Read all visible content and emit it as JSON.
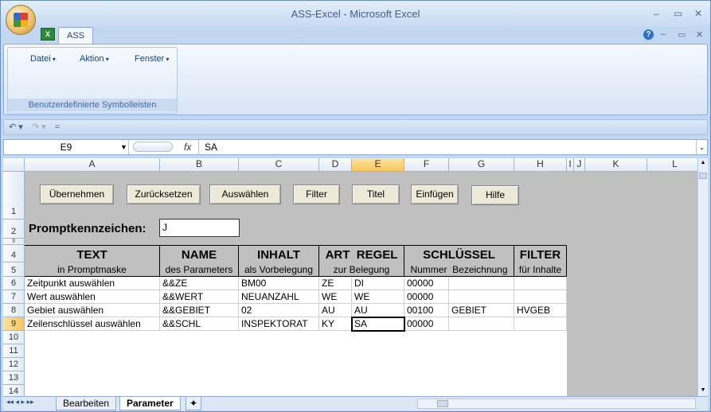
{
  "window": {
    "title": "ASS-Excel - Microsoft Excel",
    "doc_tab": "ASS",
    "min": "–",
    "max": "▭",
    "close": "✕",
    "help": "?",
    "min2": "–",
    "restore2": "▭",
    "close2": "✕"
  },
  "ribbon": {
    "menus": [
      "Datei",
      "Aktion",
      "Fenster"
    ],
    "group_label": "Benutzerdefinierte Symbolleisten"
  },
  "qat": {
    "undo": "↶ ▾",
    "redo": "↷ ▾",
    "custom": "="
  },
  "formula_bar": {
    "name_box": "E9",
    "fx": "fx",
    "value": "SA"
  },
  "columns": [
    "A",
    "B",
    "C",
    "D",
    "E",
    "F",
    "G",
    "H",
    "I",
    "J",
    "K",
    "L"
  ],
  "rows": [
    "1",
    "2",
    "3",
    "4",
    "5",
    "6",
    "7",
    "8",
    "9",
    "10",
    "11",
    "12",
    "13",
    "14"
  ],
  "buttons": [
    "Übernehmen",
    "Zurücksetzen",
    "Auswählen",
    "Filter",
    "Titel",
    "Einfügen",
    "Hilfe"
  ],
  "prompt": {
    "label": "Promptkennzeichen:",
    "value": "J"
  },
  "table_headers": {
    "top": [
      "TEXT",
      "NAME",
      "INHALT",
      "ART",
      "REGEL",
      "SCHLÜSSEL",
      "FILTER"
    ],
    "bottom": [
      "in Promptmaske",
      "des Parameters",
      "als Vorbelegung",
      "zur Belegung",
      "Nummer",
      "Bezeichnung",
      "für Inhalte"
    ]
  },
  "table_rows": [
    [
      "Zeitpunkt auswählen",
      "&&ZE",
      "BM00",
      "ZE",
      "DI",
      "00000",
      "",
      ""
    ],
    [
      "Wert auswählen",
      "&&WERT",
      "NEUANZAHL",
      "WE",
      "WE",
      "00000",
      "",
      ""
    ],
    [
      "Gebiet auswählen",
      "&&GEBIET",
      "02",
      "AU",
      "AU",
      "00100",
      "GEBIET",
      "HVGEB"
    ],
    [
      "Zeilenschlüssel auswählen",
      "&&SCHL",
      "INSPEKTORAT",
      "KY",
      "SA",
      "00000",
      "",
      ""
    ]
  ],
  "sheet_tabs": [
    "Bearbeiten",
    "Parameter"
  ],
  "sheet_nav": "◂◂ ◂ ▸ ▸▸"
}
